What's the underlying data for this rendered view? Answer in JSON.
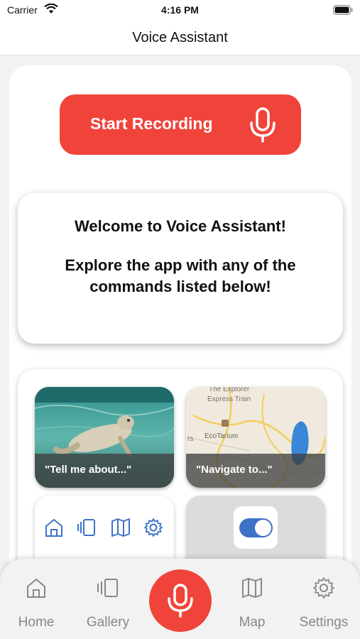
{
  "status_bar": {
    "carrier": "Carrier",
    "time": "4:16 PM"
  },
  "nav": {
    "title": "Voice Assistant"
  },
  "record": {
    "label": "Start Recording",
    "icon": "microphone-icon"
  },
  "welcome": {
    "title": "Welcome to Voice Assistant!",
    "body": "Explore the app with any of the commands listed below!"
  },
  "commands": {
    "tiles": [
      {
        "caption": "\"Tell me about...\"",
        "image": "sea-lion-photo"
      },
      {
        "caption": "\"Navigate to...\"",
        "image": "map-thumbnail",
        "map_labels": [
          "The Explorer",
          "Express Train",
          "EcoTarium",
          "rs"
        ]
      }
    ],
    "nav_icons": [
      "home-icon",
      "gallery-icon",
      "map-icon",
      "gear-icon"
    ],
    "toggle": {
      "on": true
    }
  },
  "tabs": [
    {
      "label": "Home",
      "icon": "home-icon"
    },
    {
      "label": "Gallery",
      "icon": "gallery-icon"
    },
    {
      "label": "Map",
      "icon": "map-icon"
    },
    {
      "label": "Settings",
      "icon": "gear-icon"
    }
  ],
  "colors": {
    "accent_red": "#f0443a",
    "toggle_blue": "#3d73c7",
    "icon_blue": "#3d73c7",
    "tab_gray": "#888888"
  }
}
